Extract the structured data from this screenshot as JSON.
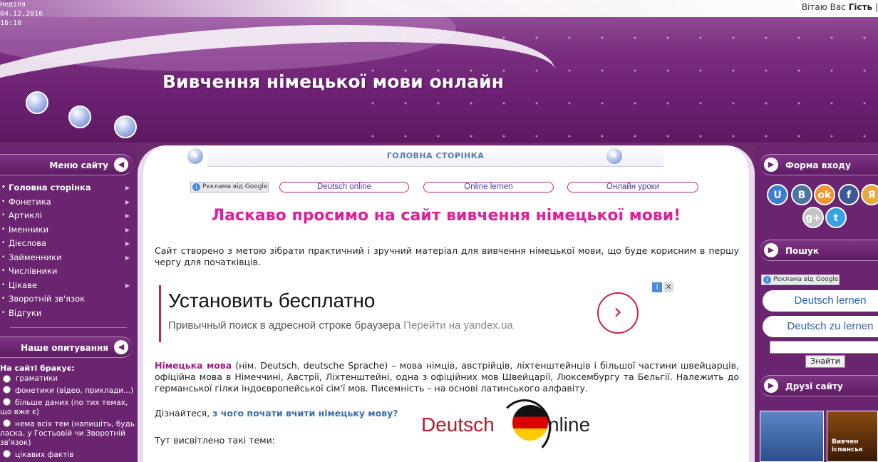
{
  "header": {
    "day": "Неділя",
    "date": "04.12.2016",
    "time": "16:10",
    "welcome_prefix": "Вітаю Вас",
    "welcome_user": "Гість",
    "welcome_sep": "|",
    "site_title": "Вивчення німецької мови онлайн"
  },
  "left": {
    "menu_title": "Меню сайту",
    "menu_items": [
      {
        "label": "Головна сторінка",
        "active": true
      },
      {
        "label": "Фонетика"
      },
      {
        "label": "Артиклі"
      },
      {
        "label": "Іменники"
      },
      {
        "label": "Дієслова"
      },
      {
        "label": "Займенники"
      },
      {
        "label": "Числівники"
      },
      {
        "label": "Цікаве"
      },
      {
        "label": "Зворотній зв'язок"
      },
      {
        "label": "Відгуки"
      }
    ],
    "poll_title": "Наше опитування",
    "poll_question": "На сайті бракує:",
    "poll_options": [
      "граматики",
      "фонетики (відео, приклади...)",
      "більше даних (по тих темах, що вже є)",
      "нема всіх тем (напишіть, будь ласка, у Гостьовій чи Зворотній зв'язок)",
      "цікавих фактів"
    ]
  },
  "center": {
    "tab_label": "ГОЛОВНА СТОРІНКА",
    "ad_google_label": "Реклама від Google",
    "ad_links": [
      "Deutsch online",
      "Online lernen",
      "Онлайн уроки"
    ],
    "heading": "Ласкаво просимо на сайт вивчення німецької мови!",
    "intro": "Сайт створено з метою зібрати практичний і зручний матеріал для вивчення німецької мови, що буде корисним в першу чергу для початківців.",
    "yandex_ad": {
      "title": "Установить бесплатно",
      "subtitle": "Привычный поиск в адресной строке браузера",
      "link": "Перейти на yandex.ua"
    },
    "about_bold": "Німецька мова",
    "about_text": " (нім. Deutsch, deutsche Sprache) – мова німців, австрійців, ліхтенштейнців і більшої частини швейцарців, офіційна мова в Німеччині, Австрії, Ліхтенштейні, одна з офіційних мов Швейцарії, Люксембургу та Бельгії. Належить до германської гілки індоєвропейської сім'ї мов. Писемність – на основі латинського алфавіту.",
    "learn_prefix": "Дізнайтеся,",
    "learn_link": "з чого почати вчити німецьку мову?",
    "topics_label": "Тут висвітлено такі теми:",
    "logo_left": "Deutsch",
    "logo_right": "nline"
  },
  "right": {
    "login_title": "Форма входу",
    "socials": [
      {
        "name": "uid",
        "glyph": "U",
        "color": "#3a7fd0"
      },
      {
        "name": "vk",
        "glyph": "B",
        "color": "#4c75a3"
      },
      {
        "name": "odnoklassniki",
        "glyph": "ok",
        "color": "#f29130"
      },
      {
        "name": "facebook",
        "glyph": "f",
        "color": "#3b5998"
      },
      {
        "name": "yandex",
        "glyph": "Я",
        "color": "#e6a93d"
      },
      {
        "name": "google-plus",
        "glyph": "g+",
        "color": "#c4c4c4"
      },
      {
        "name": "twitter",
        "glyph": "t",
        "color": "#3aa0e8"
      }
    ],
    "search_title": "Пошук",
    "ad_google_label": "Реклама від Google",
    "ad_links": [
      "Deutsch lernen",
      "Deutsch zu lernen"
    ],
    "search_button": "Знайти",
    "friends_title": "Друзі сайту",
    "friend_banner_text": "Вивчен іспанськ"
  }
}
